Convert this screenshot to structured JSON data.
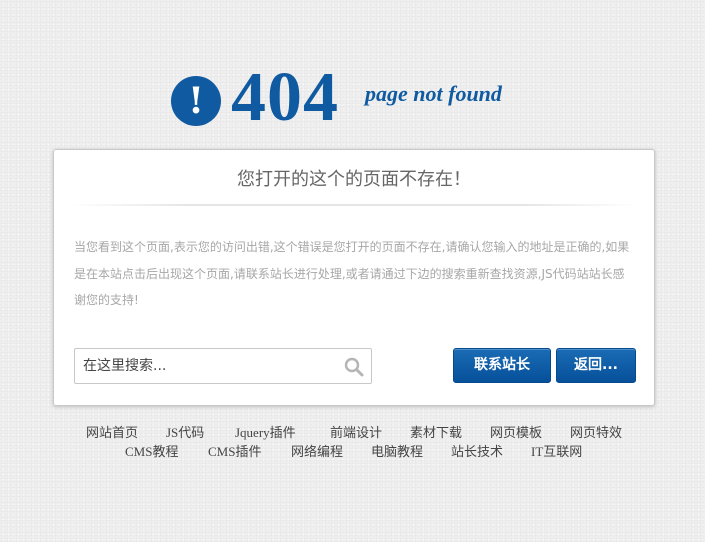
{
  "header": {
    "code": "404",
    "subtitle": "page not found",
    "icon": "exclamation-icon",
    "accent_color": "#0f5aa0"
  },
  "panel": {
    "title": "您打开的这个的页面不存在！",
    "message": "当您看到这个页面,表示您的访问出错,这个错误是您打开的页面不存在,请确认您输入的地址是正确的,如果是在本站点击后出现这个页面,请联系站长进行处理,或者请通过下边的搜索重新查找资源,JS代码站站长感谢您的支持!"
  },
  "search": {
    "placeholder": "在这里搜索...",
    "icon": "search-icon"
  },
  "buttons": {
    "contact": "联系站长",
    "back": "返回..."
  },
  "footer": {
    "row1": [
      "网站首页",
      "JS代码",
      "Jquery插件",
      "前端设计",
      "素材下载",
      "网页模板",
      "网页特效"
    ],
    "row2": [
      "CMS教程",
      "CMS插件",
      "网络编程",
      "电脑教程",
      "站长技术",
      "IT互联网"
    ]
  }
}
